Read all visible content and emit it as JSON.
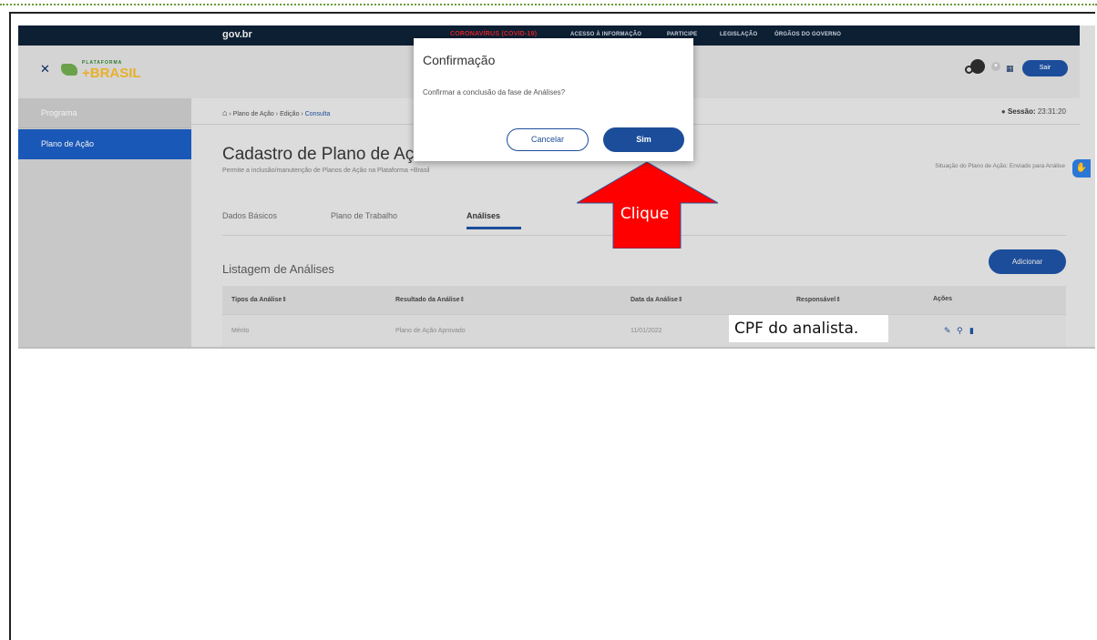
{
  "govbar": {
    "logo": "gov.br",
    "links": [
      "CORONAVÍRUS (COVID-19)",
      "ACESSO À INFORMAÇÃO",
      "PARTICIPE",
      "LEGISLAÇÃO",
      "ÓRGÃOS DO GOVERNO"
    ]
  },
  "header": {
    "brand_top": "PLATAFORMA",
    "brand_name": "+BRASIL",
    "logout_label": "Sair"
  },
  "sidebar": {
    "items": [
      {
        "label": "Programa"
      },
      {
        "label": "Plano de Ação"
      }
    ]
  },
  "breadcrumb": {
    "items": [
      "Plano de Ação",
      "Edição",
      "Consulta"
    ]
  },
  "session": {
    "label": "Sessão:",
    "time": "23:31:20"
  },
  "page": {
    "title": "Cadastro de Plano de Açã",
    "subtitle": "Permite a inclusão/manutenção de Planos de Ação na Plataforma +Brasil",
    "status": "Situação do Plano de Ação: Enviado para Análise"
  },
  "tabs": [
    {
      "label": "Dados Básicos"
    },
    {
      "label": "Plano de Trabalho"
    },
    {
      "label": "Análises"
    }
  ],
  "list": {
    "title": "Listagem de Análises",
    "add_label": "Adicionar",
    "columns": [
      "Tipos da Análise",
      "Resultado da Análise",
      "Data da Análise",
      "Responsável",
      "Ações"
    ],
    "rows": [
      {
        "tipo": "Mérito",
        "resultado": "Plano de Ação Aprovado",
        "data": "11/01/2022"
      }
    ]
  },
  "annotations": {
    "cpf_label": "CPF do analista.",
    "clique_label": "Clique",
    "arrow_color": "#ff0000"
  },
  "modal": {
    "title": "Confirmação",
    "message": "Confirmar a conclusão da fase de Análises?",
    "cancel_label": "Cancelar",
    "confirm_label": "Sim"
  },
  "colors": {
    "primary": "#1c4d9a",
    "govbar": "#0d1f33",
    "sidebar_active": "#1a58b8"
  }
}
